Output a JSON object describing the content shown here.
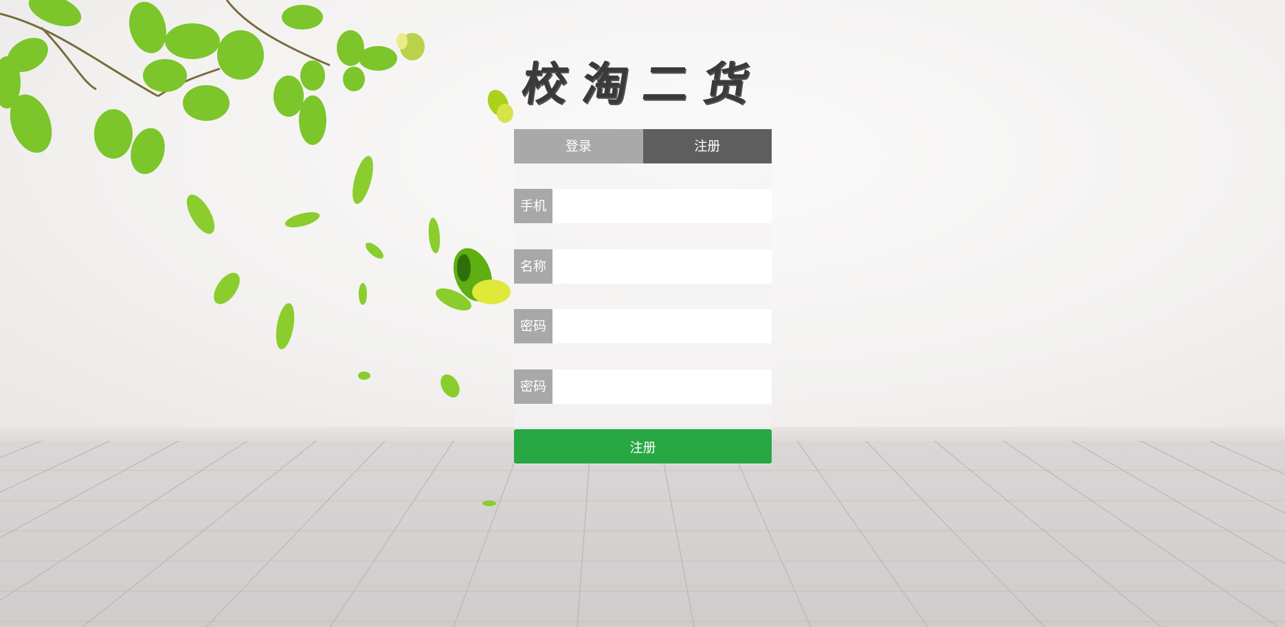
{
  "brand": {
    "logo_text": "校淘二货"
  },
  "tabs": [
    {
      "label": "登录",
      "active": false
    },
    {
      "label": "注册",
      "active": true
    }
  ],
  "form": {
    "fields": [
      {
        "label": "手机",
        "value": "",
        "placeholder": ""
      },
      {
        "label": "名称",
        "value": "",
        "placeholder": ""
      },
      {
        "label": "密码",
        "value": "",
        "placeholder": ""
      },
      {
        "label": "密码",
        "value": "",
        "placeholder": ""
      }
    ],
    "submit_label": "注册"
  },
  "colors": {
    "tab_inactive": "#a9a9a9",
    "tab_active": "#5e5e5e",
    "field_label_bg": "#a8a8a8",
    "submit_bg": "#28a745"
  },
  "decor": {
    "icons": [
      "leaf-branch-icon",
      "butterfly-icon"
    ]
  }
}
